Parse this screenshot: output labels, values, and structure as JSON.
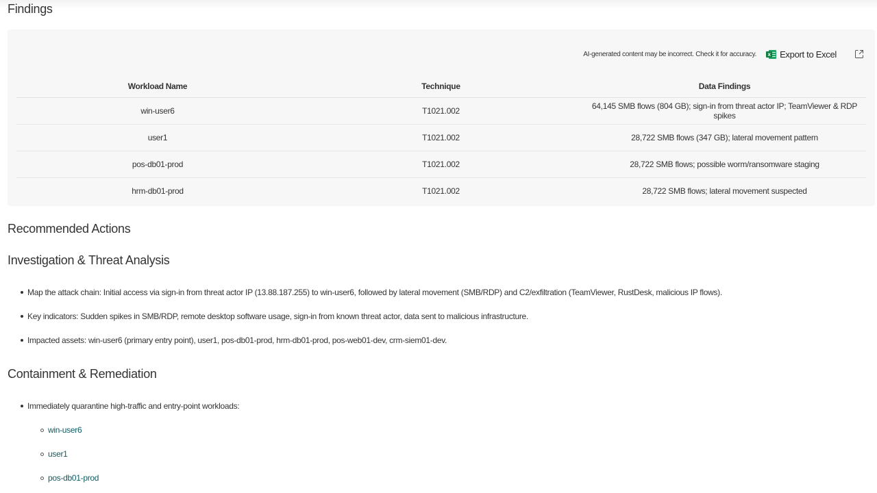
{
  "findings": {
    "title": "Findings",
    "ai_note": "AI-generated content may be incorrect. Check it for accuracy.",
    "export_label": "Export to Excel",
    "columns": [
      "Workload Name",
      "Technique",
      "Data Findings"
    ],
    "rows": [
      {
        "workload": "win-user6",
        "technique": "T1021.002",
        "findings": "64,145 SMB flows (804 GB); sign-in from threat actor IP; TeamViewer & RDP spikes"
      },
      {
        "workload": "user1",
        "technique": "T1021.002",
        "findings": "28,722 SMB flows (347 GB); lateral movement pattern"
      },
      {
        "workload": "pos-db01-prod",
        "technique": "T1021.002",
        "findings": "28,722 SMB flows; possible worm/ransomware staging"
      },
      {
        "workload": "hrm-db01-prod",
        "technique": "T1021.002",
        "findings": "28,722 SMB flows; lateral movement suspected"
      }
    ]
  },
  "recommended": {
    "title": "Recommended Actions"
  },
  "investigation": {
    "title": "Investigation & Threat Analysis",
    "bullets": [
      "Map the attack chain: Initial access via sign-in from threat actor IP (13.88.187.255) to win-user6, followed by lateral movement (SMB/RDP) and C2/exfiltration (TeamViewer, RustDesk, malicious IP flows).",
      "Key indicators: Sudden spikes in SMB/RDP, remote desktop software usage, sign-in from known threat actor, data sent to malicious infrastructure.",
      "Impacted assets: win-user6 (primary entry point), user1, pos-db01-prod, hrm-db01-prod, pos-web01-dev, crm-siem01-dev."
    ]
  },
  "containment": {
    "title": "Containment & Remediation",
    "bullets": [
      "Immediately quarantine high-traffic and entry-point workloads:"
    ],
    "sub_items": [
      "win-user6",
      "user1",
      "pos-db01-prod"
    ]
  },
  "icons": {
    "export": "excel-icon",
    "expand": "expand-icon"
  },
  "colors": {
    "card_bg": "#f7f7f7",
    "link": "#0f5b62",
    "excel_green": "#107c41"
  }
}
